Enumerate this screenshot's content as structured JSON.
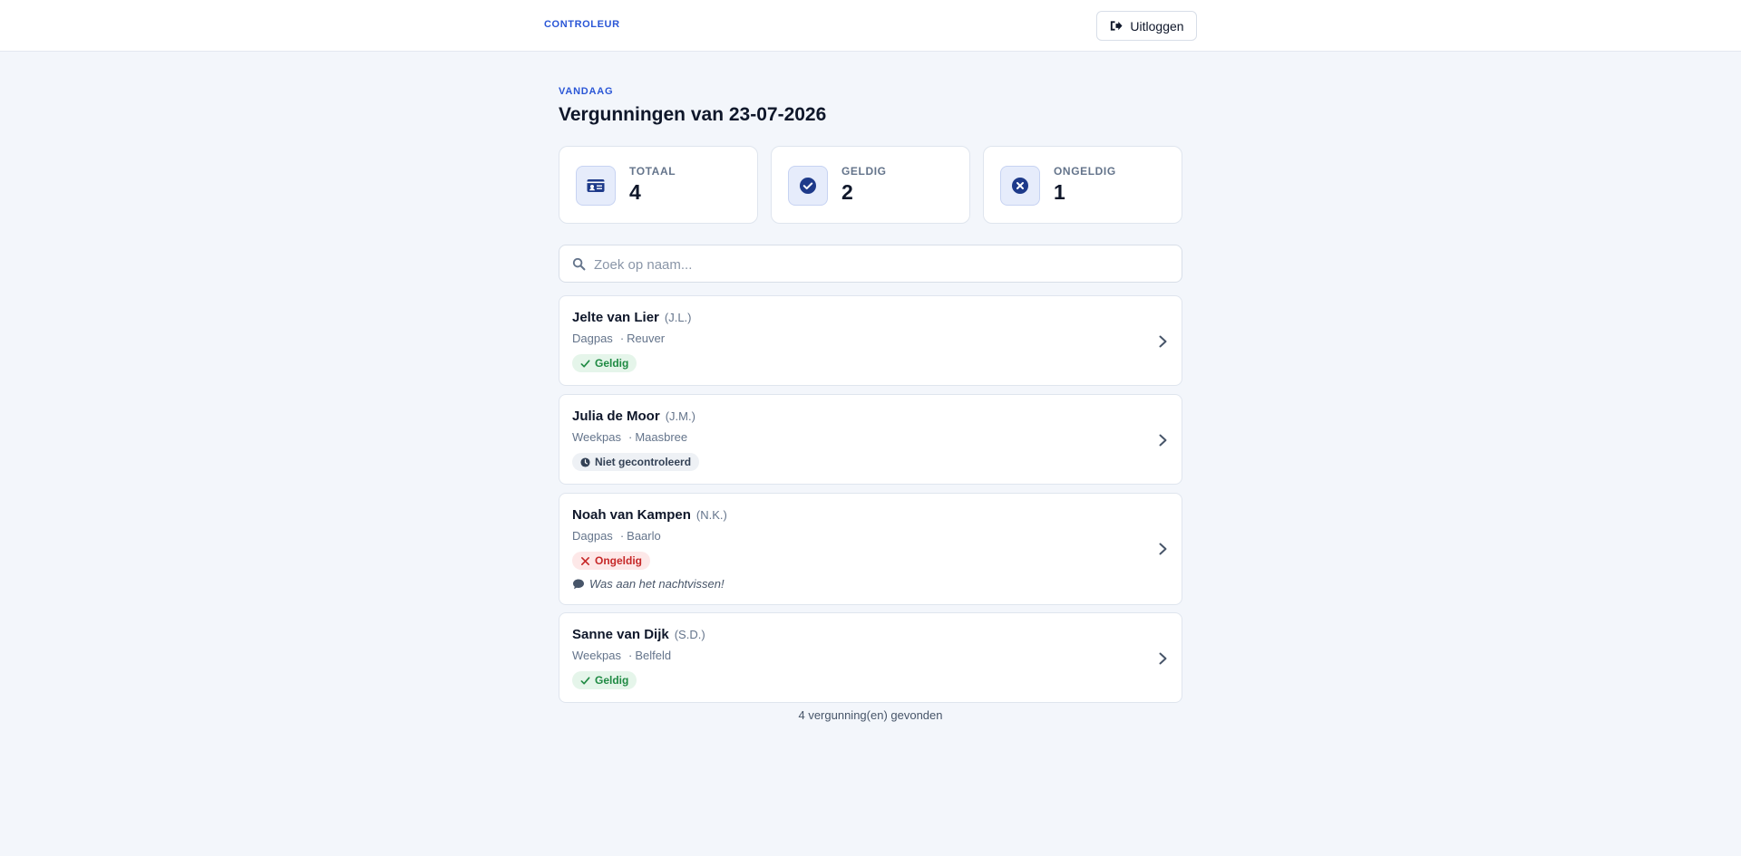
{
  "header": {
    "brand": "CONTROLEUR",
    "logout_label": "Uitloggen"
  },
  "page": {
    "eyebrow": "VANDAAG",
    "title": "Vergunningen van 23-07-2026"
  },
  "stats": [
    {
      "label": "TOTAAL",
      "value": "4",
      "icon": "id-card-icon"
    },
    {
      "label": "GELDIG",
      "value": "2",
      "icon": "check-circle-icon"
    },
    {
      "label": "ONGELDIG",
      "value": "1",
      "icon": "x-circle-icon"
    }
  ],
  "search": {
    "placeholder": "Zoek op naam...",
    "value": ""
  },
  "permits": [
    {
      "name": "Jelte van Lier",
      "initials": "(J.L.)",
      "type": "Dagpas",
      "location": "Reuver",
      "status": "Geldig",
      "status_kind": "valid"
    },
    {
      "name": "Julia de Moor",
      "initials": "(J.M.)",
      "type": "Weekpas",
      "location": "Maasbree",
      "status": "Niet gecontroleerd",
      "status_kind": "unchecked"
    },
    {
      "name": "Noah van Kampen",
      "initials": "(N.K.)",
      "type": "Dagpas",
      "location": "Baarlo",
      "status": "Ongeldig",
      "status_kind": "invalid",
      "note": "Was aan het nachtvissen!"
    },
    {
      "name": "Sanne van Dijk",
      "initials": "(S.D.)",
      "type": "Weekpas",
      "location": "Belfeld",
      "status": "Geldig",
      "status_kind": "valid"
    }
  ],
  "footer": {
    "count_text": "4 vergunning(en) gevonden"
  },
  "colors": {
    "accent": "#2a56d6",
    "valid": "#1f8a43",
    "invalid": "#c62828",
    "background": "#f3f6fb"
  }
}
